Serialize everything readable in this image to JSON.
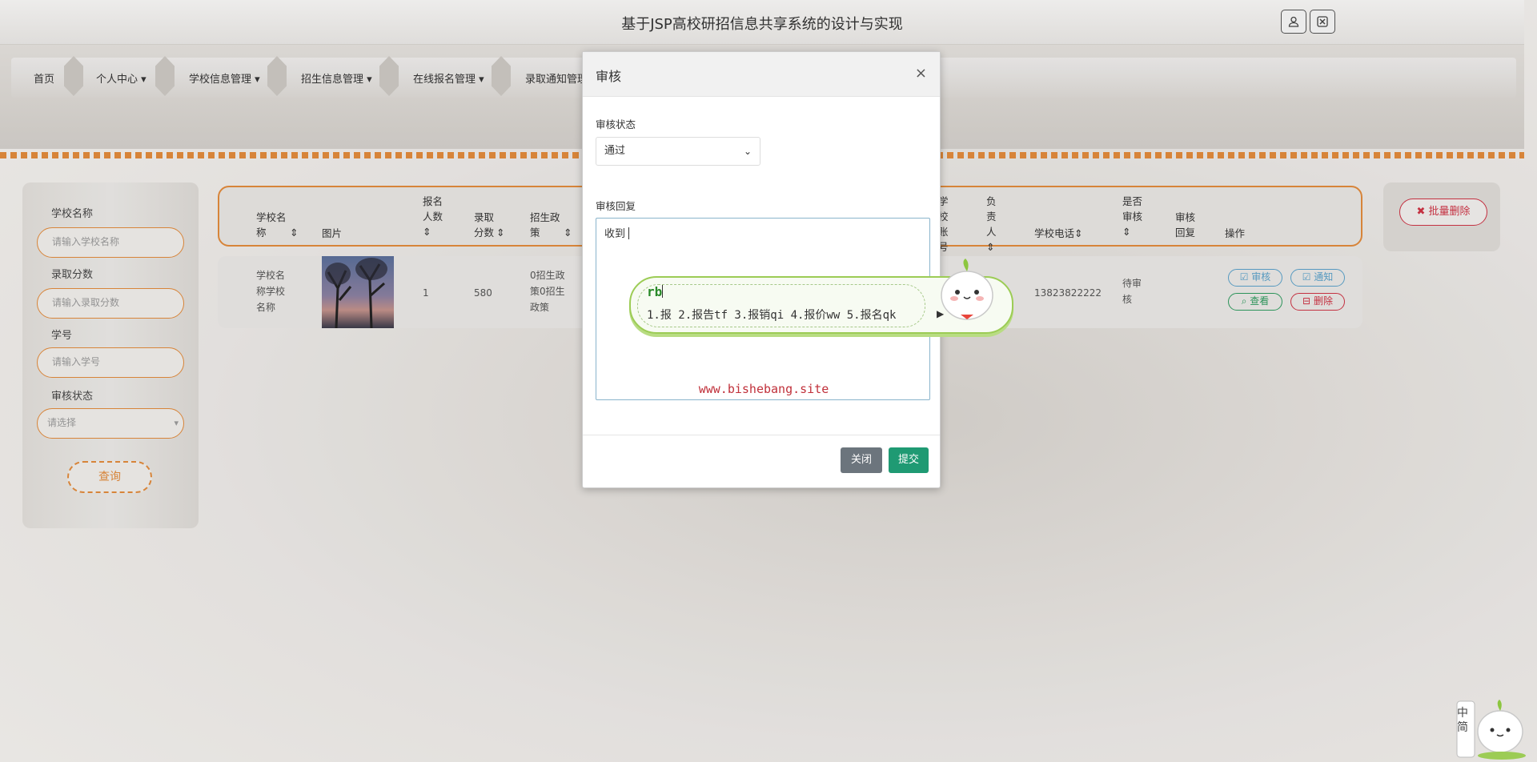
{
  "header": {
    "title": "基于JSP高校研招信息共享系统的设计与实现"
  },
  "nav": {
    "items": [
      "首页",
      "个人中心",
      "学校信息管理",
      "招生信息管理",
      "在线报名管理",
      "录取通知管理"
    ]
  },
  "search": {
    "school_name_label": "学校名称",
    "school_name_placeholder": "请输入学校名称",
    "score_label": "录取分数",
    "score_placeholder": "请输入录取分数",
    "student_id_label": "学号",
    "student_id_placeholder": "请输入学号",
    "review_status_label": "审核状态",
    "review_status_placeholder": "请选择",
    "query_button": "查询"
  },
  "toolbar": {
    "batch_delete": "批量删除"
  },
  "table": {
    "headers": {
      "school_name": "学校名称",
      "image": "图片",
      "applicants": "报名人数",
      "score": "录取分数",
      "policy": "招生政策",
      "school_no": "学校账号",
      "contact": "负责人",
      "phone": "学校电话",
      "is_reviewed": "是否审核",
      "reply": "审核回复",
      "actions": "操作"
    },
    "rows": [
      {
        "school_name": "学校名称学校名称",
        "applicants": "1",
        "score": "580",
        "policy": "0招生政策0招生政策",
        "phone": "13823822222",
        "is_reviewed": "待审核"
      }
    ],
    "actions": {
      "review": "审核",
      "notify": "通知",
      "view": "查看",
      "delete": "删除"
    }
  },
  "modal": {
    "title": "审核",
    "status_label": "审核状态",
    "status_value": "通过",
    "reply_label": "审核回复",
    "reply_value": "收到",
    "watermark": "www.bishebang.site",
    "close_button": "关闭",
    "submit_button": "提交"
  },
  "ime": {
    "code": "rb",
    "candidates": "1.报  2.报告tf  3.报销qi  4.报价ww  5.报名qk"
  },
  "corner_widget": {
    "label": "中简"
  }
}
